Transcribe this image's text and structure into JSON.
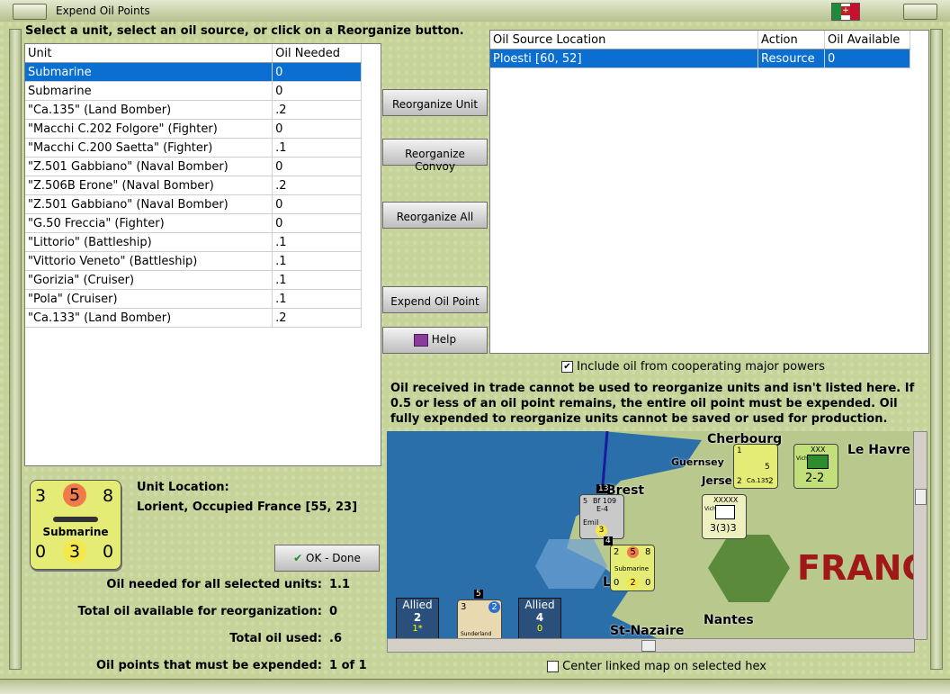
{
  "window": {
    "title": "Expend Oil Points"
  },
  "instruction": "Select a unit, select an oil source, or click on a Reorganize button.",
  "units_table": {
    "headers": [
      "Unit",
      "Oil Needed"
    ],
    "rows": [
      {
        "unit": "Submarine",
        "oil": "0"
      },
      {
        "unit": "Submarine",
        "oil": "0"
      },
      {
        "unit": "\"Ca.135\" (Land Bomber)",
        "oil": ".2"
      },
      {
        "unit": "\"Macchi C.202 Folgore\" (Fighter)",
        "oil": "0"
      },
      {
        "unit": "\"Macchi C.200 Saetta\" (Fighter)",
        "oil": ".1"
      },
      {
        "unit": "\"Z.501 Gabbiano\" (Naval Bomber)",
        "oil": "0"
      },
      {
        "unit": "\"Z.506B Erone\" (Naval Bomber)",
        "oil": ".2"
      },
      {
        "unit": "\"Z.501 Gabbiano\" (Naval Bomber)",
        "oil": "0"
      },
      {
        "unit": "\"G.50 Freccia\" (Fighter)",
        "oil": "0"
      },
      {
        "unit": "\"Littorio\" (Battleship)",
        "oil": ".1"
      },
      {
        "unit": "\"Vittorio Veneto\" (Battleship)",
        "oil": ".1"
      },
      {
        "unit": "\"Gorizia\" (Cruiser)",
        "oil": ".1"
      },
      {
        "unit": "\"Pola\" (Cruiser)",
        "oil": ".1"
      },
      {
        "unit": "\"Ca.133\" (Land Bomber)",
        "oil": ".2"
      }
    ]
  },
  "buttons": {
    "reorganize_unit": "Reorganize Unit",
    "reorganize_convoy": "Reorganize Convoy",
    "reorganize_all": "Reorganize All",
    "expend_oil_point": "Expend Oil Point",
    "help": "Help",
    "ok_done": "OK - Done"
  },
  "sources_table": {
    "headers": [
      "Oil Source Location",
      "Action",
      "Oil Available"
    ],
    "rows": [
      {
        "location": "Ploesti [60, 52]",
        "action": "Resource",
        "available": "0"
      }
    ]
  },
  "checkbox_cooperating": {
    "label": "Include oil from cooperating major powers",
    "checked": true
  },
  "info_text": "Oil received in trade cannot be used to reorganize units and isn't listed here.  If 0.5 or less of an oil point remains, the entire oil point must be expended.   Oil fully expended to reorganize units cannot be saved or used for production.",
  "unit_counter": {
    "attack": "3",
    "move": "5",
    "range": "8",
    "name": "Submarine",
    "defense": "0",
    "factor": "3",
    "extra": "0"
  },
  "unit_location": {
    "label": "Unit Location:",
    "value": "Lorient, Occupied France [55, 23]"
  },
  "summary": {
    "oil_needed_label": "Oil needed for all selected units:",
    "oil_needed_value": "1.1",
    "total_avail_label": "Total oil available for reorganization:",
    "total_avail_value": "0",
    "total_used_label": "Total oil used:",
    "total_used_value": ".6",
    "must_expend_label": "Oil points that must be expended:",
    "must_expend_value": "1 of 1"
  },
  "map": {
    "places": [
      "Cherbourg",
      "Le Havre",
      "Guernsey",
      "Jerse",
      "Brest",
      "St-Nazaire",
      "Nantes",
      "FRANC",
      "L"
    ],
    "counters": {
      "bf109": {
        "a": "5",
        "b": "Bf 109",
        "c": "E-4",
        "d": "Emil",
        "e": "3",
        "badge": "13"
      },
      "ca135": {
        "a": "1",
        "b": "5",
        "c": "Ca.135",
        "d": "2",
        "e": "2"
      },
      "corps": {
        "size": "XXX",
        "name": "Vichy",
        "val": "2-2"
      },
      "army": {
        "size": "XXXXX",
        "name": "Vichy",
        "val": "3(3)3"
      },
      "sub": {
        "a": "2",
        "b": "5",
        "c": "8",
        "name": "Submarine",
        "d": "0",
        "e": "2",
        "f": "0",
        "badge": "4"
      },
      "sunderland": {
        "a": "3",
        "b": "2",
        "name": "Sunderland",
        "badge": "5"
      }
    },
    "allied_left": {
      "label": "Allied",
      "num": "2",
      "sub": "1*"
    },
    "allied_right": {
      "label": "Allied",
      "num": "4",
      "sub": "0"
    }
  },
  "checkbox_center": {
    "label": "Center linked map on selected hex",
    "checked": false
  }
}
